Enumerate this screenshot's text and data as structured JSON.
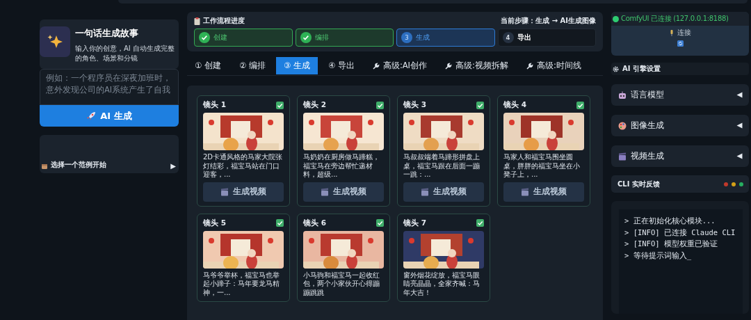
{
  "story": {
    "title": "一句话生成故事",
    "description": "输入你的创意，AI 自动生成完整的角色、场景和分镜",
    "placeholder": "例如：一个程序员在深夜加班时，意外发现公司的AI系统产生了自我",
    "generate_button": "AI 生成"
  },
  "examples": {
    "label": "选择一个范例开始",
    "toggle": "▶",
    "expanded": false
  },
  "workflow": {
    "title": "工作流程进度",
    "current_step": "当前步骤：生成 → AI生成图像",
    "steps": [
      {
        "label": "创建",
        "completed": true,
        "selected": false
      },
      {
        "label": "编排",
        "completed": true,
        "selected": false
      },
      {
        "number": "3",
        "label": "生成",
        "completed": false,
        "selected": true
      },
      {
        "number": "4",
        "label": "导出",
        "completed": false,
        "selected": false
      }
    ]
  },
  "tabs": [
    {
      "label": "① 创建",
      "kind": "step",
      "selected": false
    },
    {
      "label": "② 编排",
      "kind": "step",
      "selected": false
    },
    {
      "label": "③ 生成",
      "kind": "step",
      "selected": true
    },
    {
      "label": "④ 导出",
      "kind": "step",
      "selected": false
    },
    {
      "label": "高级:AI创作",
      "kind": "tool",
      "selected": false
    },
    {
      "label": "高级:视频拆解",
      "kind": "tool",
      "selected": false
    },
    {
      "label": "高级:时间线",
      "kind": "tool",
      "selected": false
    }
  ],
  "shots": [
    {
      "title": "镜头 1",
      "checked": true,
      "description": "2D卡通风格的马家大院张灯结彩，福宝马站在门口迎客，...",
      "button": "生成视频"
    },
    {
      "title": "镜头 2",
      "checked": true,
      "description": "马奶奶在厨房做马蹄糕，福宝马在旁边帮忙递材料，超级...",
      "button": "生成视频"
    },
    {
      "title": "镜头 3",
      "checked": true,
      "description": "马叔叔端着马蹄形拼盘上桌，福宝马跟在后面一蹦一跳：...",
      "button": "生成视频"
    },
    {
      "title": "镜头 4",
      "checked": true,
      "description": "马家人和福宝马围坐圆桌，胖胖的福宝马坐在小凳子上，...",
      "button": "生成视频"
    },
    {
      "title": "镜头 5",
      "checked": true,
      "description": "马爷爷举杯，福宝马也举起小蹄子：马年要龙马精神，一..."
    },
    {
      "title": "镜头 6",
      "checked": true,
      "description": "小马驹和福宝马一起收红包，两个小家伙开心得蹦蹦跳跳"
    },
    {
      "title": "镜头 7",
      "checked": true,
      "description": "窗外烟花绽放，福宝马眼睛亮晶晶，全家齐喊：马年大吉！"
    }
  ],
  "connection": {
    "status": "ComfyUI 已连接 (127.0.0.1:8188)",
    "connected": true,
    "connect_button": "连接"
  },
  "engine": {
    "title": "AI 引擎设置",
    "sections": [
      {
        "label": "语言模型",
        "kind": "robot",
        "expanded": false
      },
      {
        "label": "图像生成",
        "kind": "palette",
        "expanded": false
      },
      {
        "label": "视频生成",
        "kind": "clapper",
        "expanded": false
      }
    ]
  },
  "cli": {
    "title": "CLI 实时反馈",
    "dots": [
      {
        "color": "#c0392b"
      },
      {
        "color": "#d4a017"
      },
      {
        "color": "#27ae60"
      }
    ],
    "lines": [
      "> 正在初始化核心模块...",
      "> [INFO] 已连接 Claude CLI",
      "> [INFO] 模型权重已验证",
      "> 等待提示词输入_"
    ]
  }
}
